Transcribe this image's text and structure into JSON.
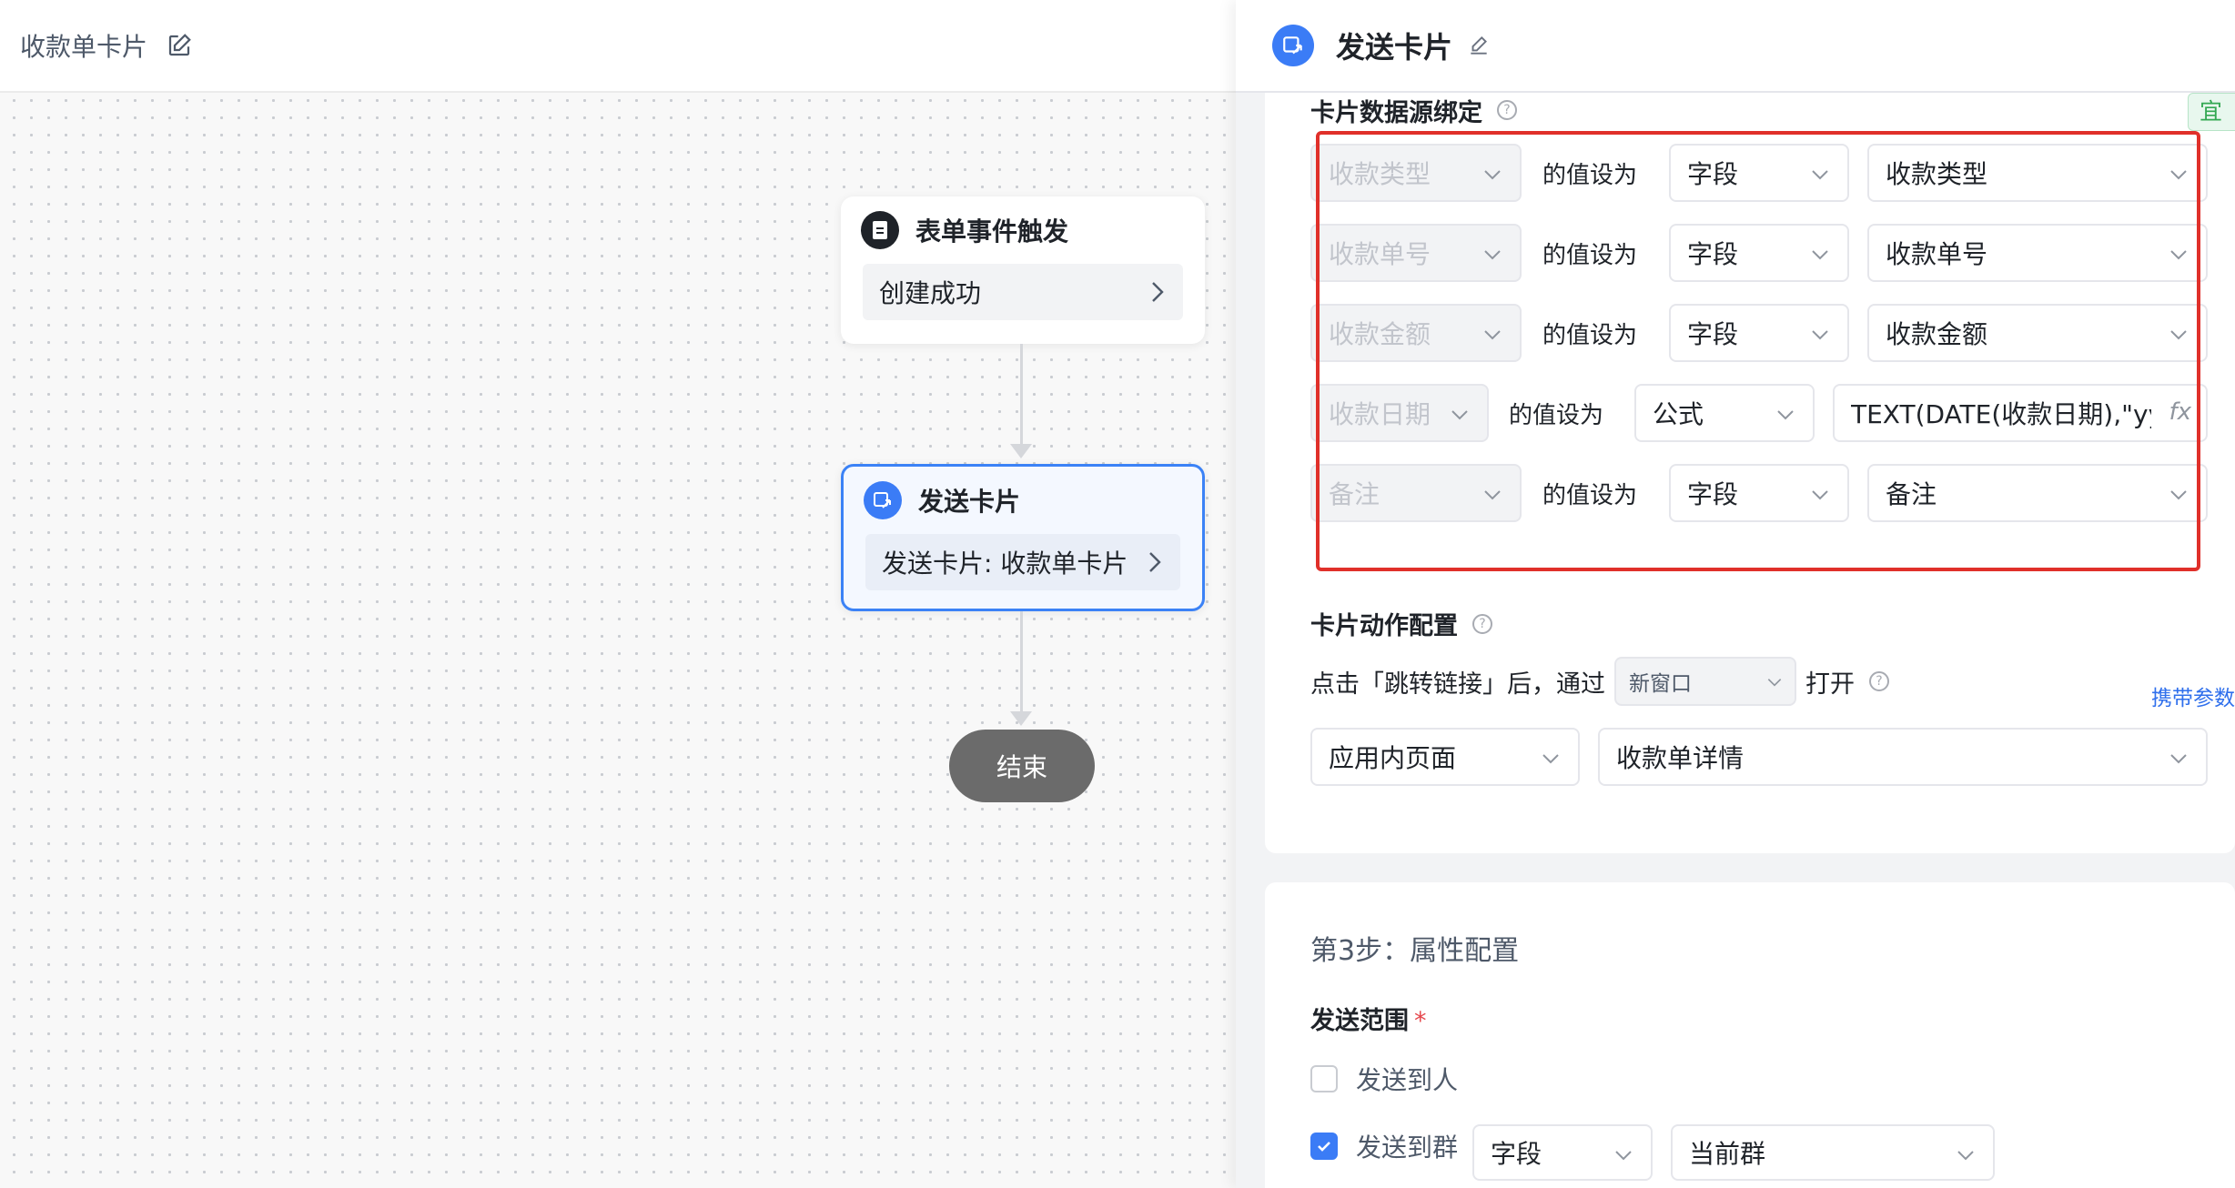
{
  "canvas": {
    "title": "收款单卡片",
    "trigger_node": {
      "title": "表单事件触发",
      "detail": "创建成功"
    },
    "send_node": {
      "title": "发送卡片",
      "detail": "发送卡片: 收款单卡片"
    },
    "end_node": {
      "label": "结束"
    }
  },
  "panel": {
    "title": "发送卡片",
    "data_binding": {
      "title": "卡片数据源绑定",
      "side_tag": "宜搭",
      "set_label": "的值设为",
      "rows": [
        {
          "target": "收款类型",
          "type": "字段",
          "value": "收款类型"
        },
        {
          "target": "收款单号",
          "type": "字段",
          "value": "收款单号"
        },
        {
          "target": "收款金额",
          "type": "字段",
          "value": "收款金额"
        },
        {
          "target": "收款日期",
          "type": "公式",
          "value": "TEXT(DATE(收款日期),\"yyyy"
        },
        {
          "target": "备注",
          "type": "字段",
          "value": "备注"
        }
      ]
    },
    "action_config": {
      "title": "卡片动作配置",
      "sentence_prefix": "点击「跳转链接」后，通过",
      "window_option": "新窗口",
      "sentence_suffix": "打开",
      "carry_params": "携带参数",
      "page_type": "应用内页面",
      "page_value": "收款单详情"
    },
    "step3": {
      "title": "第3步：属性配置",
      "range_label": "发送范围",
      "required_mark": "*",
      "option_person": "发送到人",
      "option_group": "发送到群",
      "group_type": "字段",
      "group_value": "当前群"
    }
  }
}
